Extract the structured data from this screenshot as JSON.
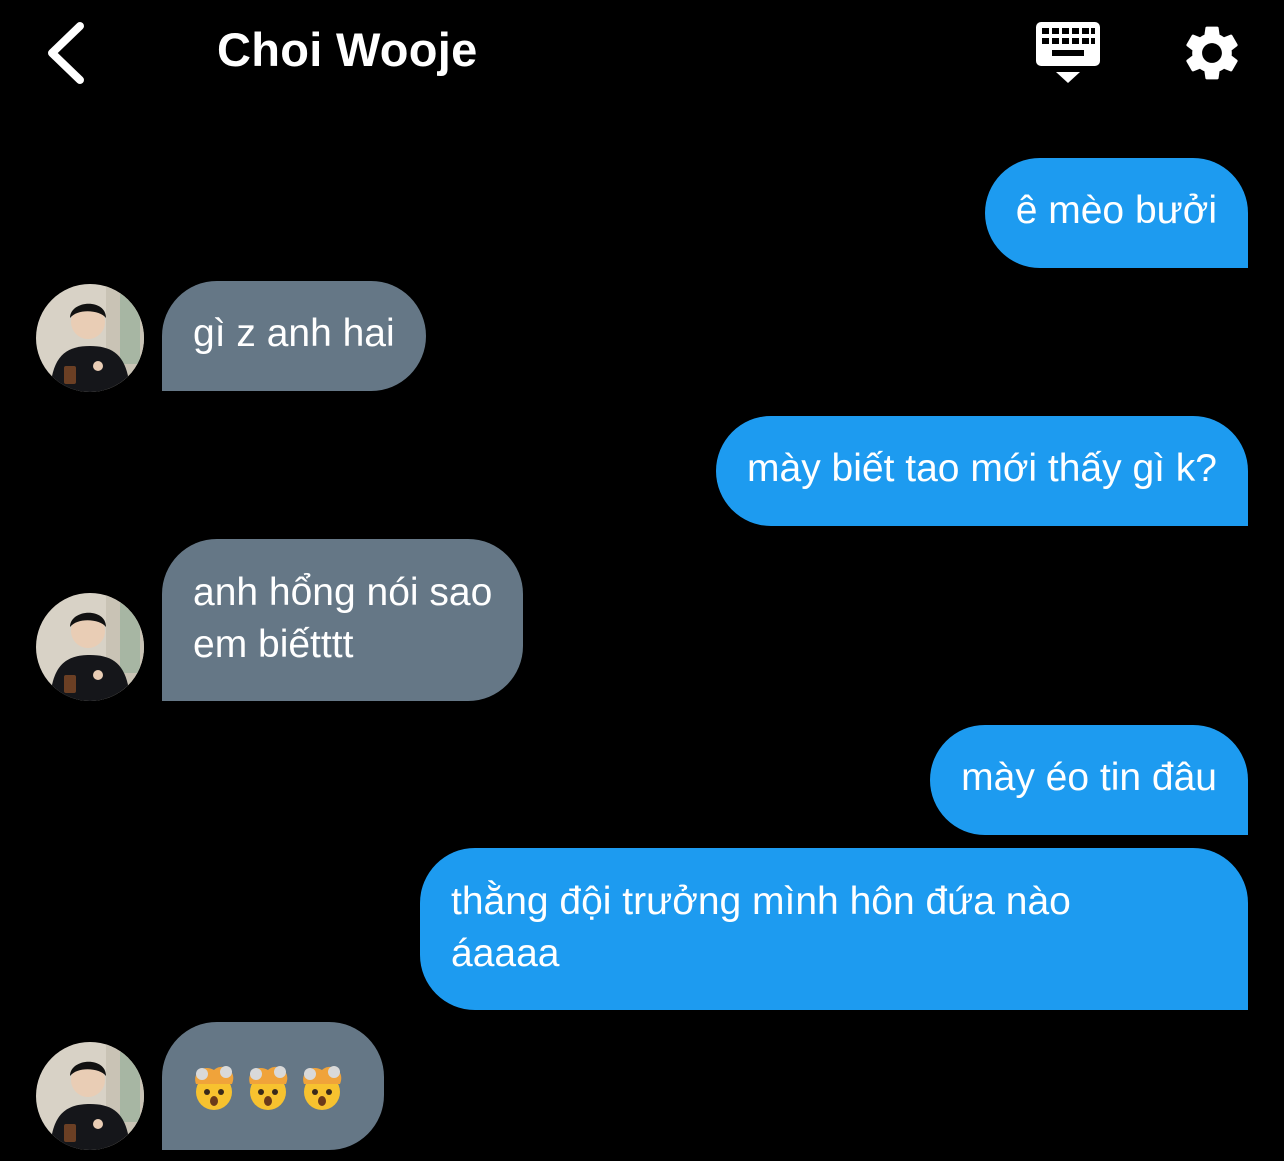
{
  "header": {
    "title": "Choi Wooje",
    "back_icon": "chevron-left-icon",
    "keyboard_icon": "keyboard-hide-icon",
    "settings_icon": "gear-icon"
  },
  "colors": {
    "background": "#000000",
    "outgoing_bubble": "#1d9bf0",
    "incoming_bubble": "#657786",
    "text": "#ffffff"
  },
  "messages": [
    {
      "direction": "outgoing",
      "lines": [
        "ê mèo bưởi"
      ]
    },
    {
      "direction": "incoming",
      "lines": [
        "gì z anh hai"
      ]
    },
    {
      "direction": "outgoing",
      "lines": [
        "mày biết tao mới thấy gì k?"
      ]
    },
    {
      "direction": "incoming",
      "lines": [
        "anh hổng nói sao",
        "em biếtttt"
      ]
    },
    {
      "direction": "outgoing",
      "lines": [
        "mày éo tin đâu"
      ]
    },
    {
      "direction": "outgoing",
      "lines": [
        "thằng đội trưởng mình hôn đứa nào",
        "áaaaa"
      ]
    },
    {
      "direction": "incoming",
      "emoji": "exploding-head-emoji",
      "emoji_count": 3
    }
  ]
}
